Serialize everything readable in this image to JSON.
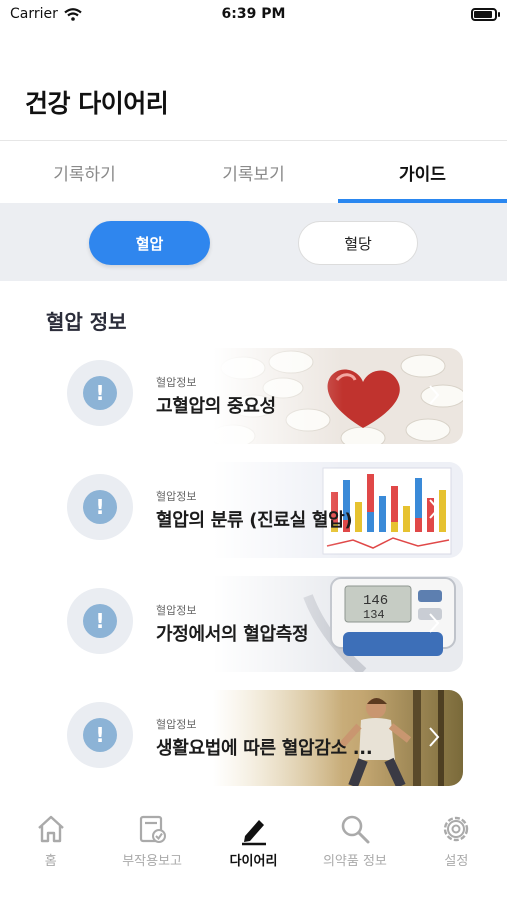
{
  "status_bar": {
    "carrier": "Carrier",
    "time": "6:39 PM"
  },
  "header": {
    "title": "건강 다이어리"
  },
  "tabs": [
    {
      "label": "기록하기",
      "active": false
    },
    {
      "label": "기록보기",
      "active": false
    },
    {
      "label": "가이드",
      "active": true
    }
  ],
  "segment": {
    "selected": "혈압",
    "other": "혈당"
  },
  "section": {
    "title": "혈압 정보"
  },
  "cards": [
    {
      "category": "혈압정보",
      "title": "고혈압의 중요성",
      "image": "heart-pills-photo"
    },
    {
      "category": "혈압정보",
      "title": "혈압의 분류 (진료실 혈압)",
      "image": "bar-chart-photo"
    },
    {
      "category": "혈압정보",
      "title": "가정에서의 혈압측정",
      "image": "blood-pressure-monitor-photo"
    },
    {
      "category": "혈압정보",
      "title": "생활요법에 따른 혈압감소 ...",
      "image": "runner-photo"
    }
  ],
  "bottom_nav": [
    {
      "label": "홈",
      "icon": "home-icon",
      "active": false
    },
    {
      "label": "부작용보고",
      "icon": "report-icon",
      "active": false
    },
    {
      "label": "다이어리",
      "icon": "pen-icon",
      "active": true
    },
    {
      "label": "의약품 정보",
      "icon": "search-icon",
      "active": false
    },
    {
      "label": "설정",
      "icon": "gear-icon",
      "active": false
    }
  ],
  "colors": {
    "accent": "#2f86ee",
    "tab_indicator": "#2a87f0",
    "info_icon": "#8cb3d6"
  }
}
